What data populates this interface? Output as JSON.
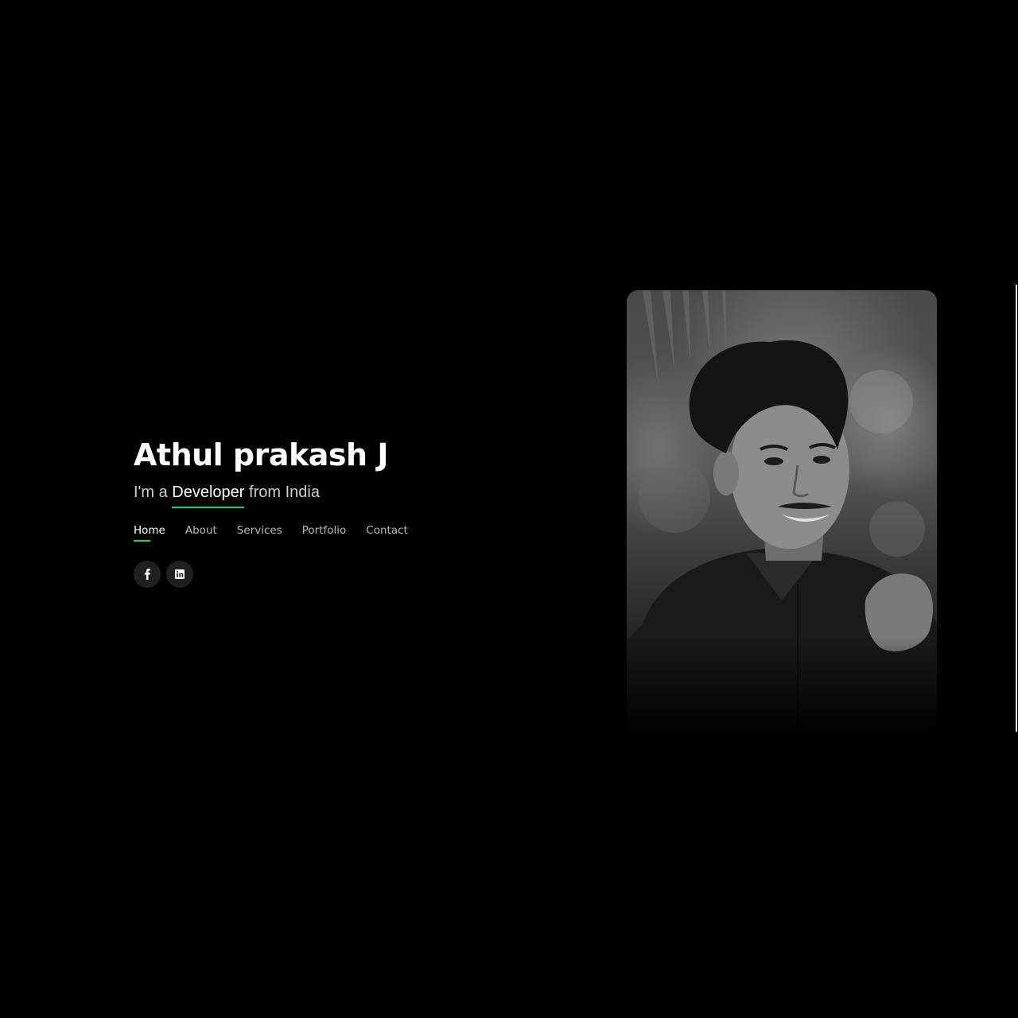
{
  "hero": {
    "name": "Athul prakash J",
    "tagline_prefix": "I'm a ",
    "tagline_role": "Developer",
    "tagline_suffix": " from India"
  },
  "nav": {
    "items": [
      {
        "label": "Home",
        "active": true
      },
      {
        "label": "About",
        "active": false
      },
      {
        "label": "Services",
        "active": false
      },
      {
        "label": "Portfolio",
        "active": false
      },
      {
        "label": "Contact",
        "active": false
      }
    ]
  },
  "socials": {
    "items": [
      {
        "icon": "facebook-icon"
      },
      {
        "icon": "linkedin-icon"
      }
    ]
  },
  "colors": {
    "background": "#000000",
    "accent": "#18d26e",
    "text": "#ffffff",
    "muted_text": "#b8b8b8"
  },
  "photo": {
    "subject": "portrait-photo"
  }
}
